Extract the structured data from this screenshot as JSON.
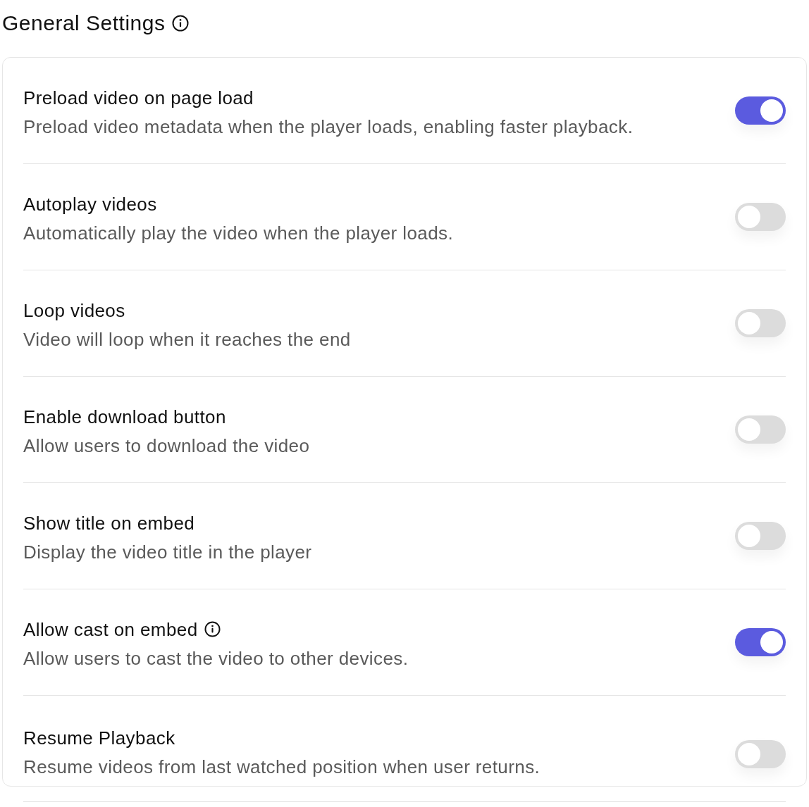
{
  "header": {
    "title": "General Settings"
  },
  "settings": [
    {
      "title": "Preload video on page load",
      "description": "Preload video metadata when the player loads, enabling faster playback.",
      "has_info": false,
      "on": true
    },
    {
      "title": "Autoplay videos",
      "description": "Automatically play the video when the player loads.",
      "has_info": false,
      "on": false
    },
    {
      "title": "Loop videos",
      "description": "Video will loop when it reaches the end",
      "has_info": false,
      "on": false
    },
    {
      "title": "Enable download button",
      "description": "Allow users to download the video",
      "has_info": false,
      "on": false
    },
    {
      "title": "Show title on embed",
      "description": "Display the video title in the player",
      "has_info": false,
      "on": false
    },
    {
      "title": "Allow cast on embed",
      "description": "Allow users to cast the video to other devices.",
      "has_info": true,
      "on": true
    },
    {
      "title": "Resume Playback",
      "description": "Resume videos from last watched position when user returns.",
      "has_info": false,
      "on": false
    }
  ]
}
